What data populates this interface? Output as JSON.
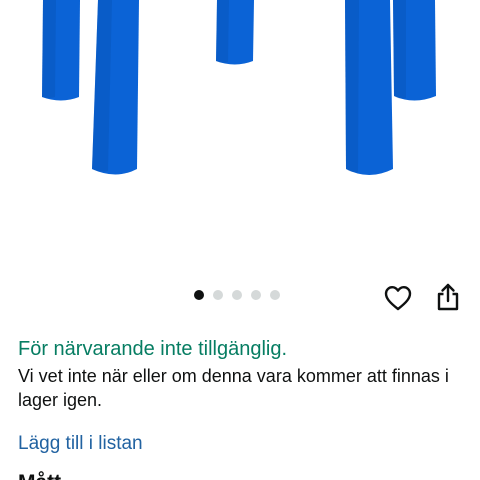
{
  "product_image": {
    "alt": "Blue stool legs",
    "color": "#0b63d6"
  },
  "carousel": {
    "total": 5,
    "active_index": 0
  },
  "actions": {
    "wishlist_icon": "heart-outline-icon",
    "share_icon": "share-icon"
  },
  "availability": {
    "status": "För närvarande inte tillgänglig.",
    "detail": "Vi vet inte när eller om denna vara kommer att finnas i lager igen.",
    "status_color": "#067d62"
  },
  "add_to_list": {
    "label": "Lägg till i listan",
    "color": "#2162a1"
  },
  "next_section": {
    "heading": "Mått"
  }
}
